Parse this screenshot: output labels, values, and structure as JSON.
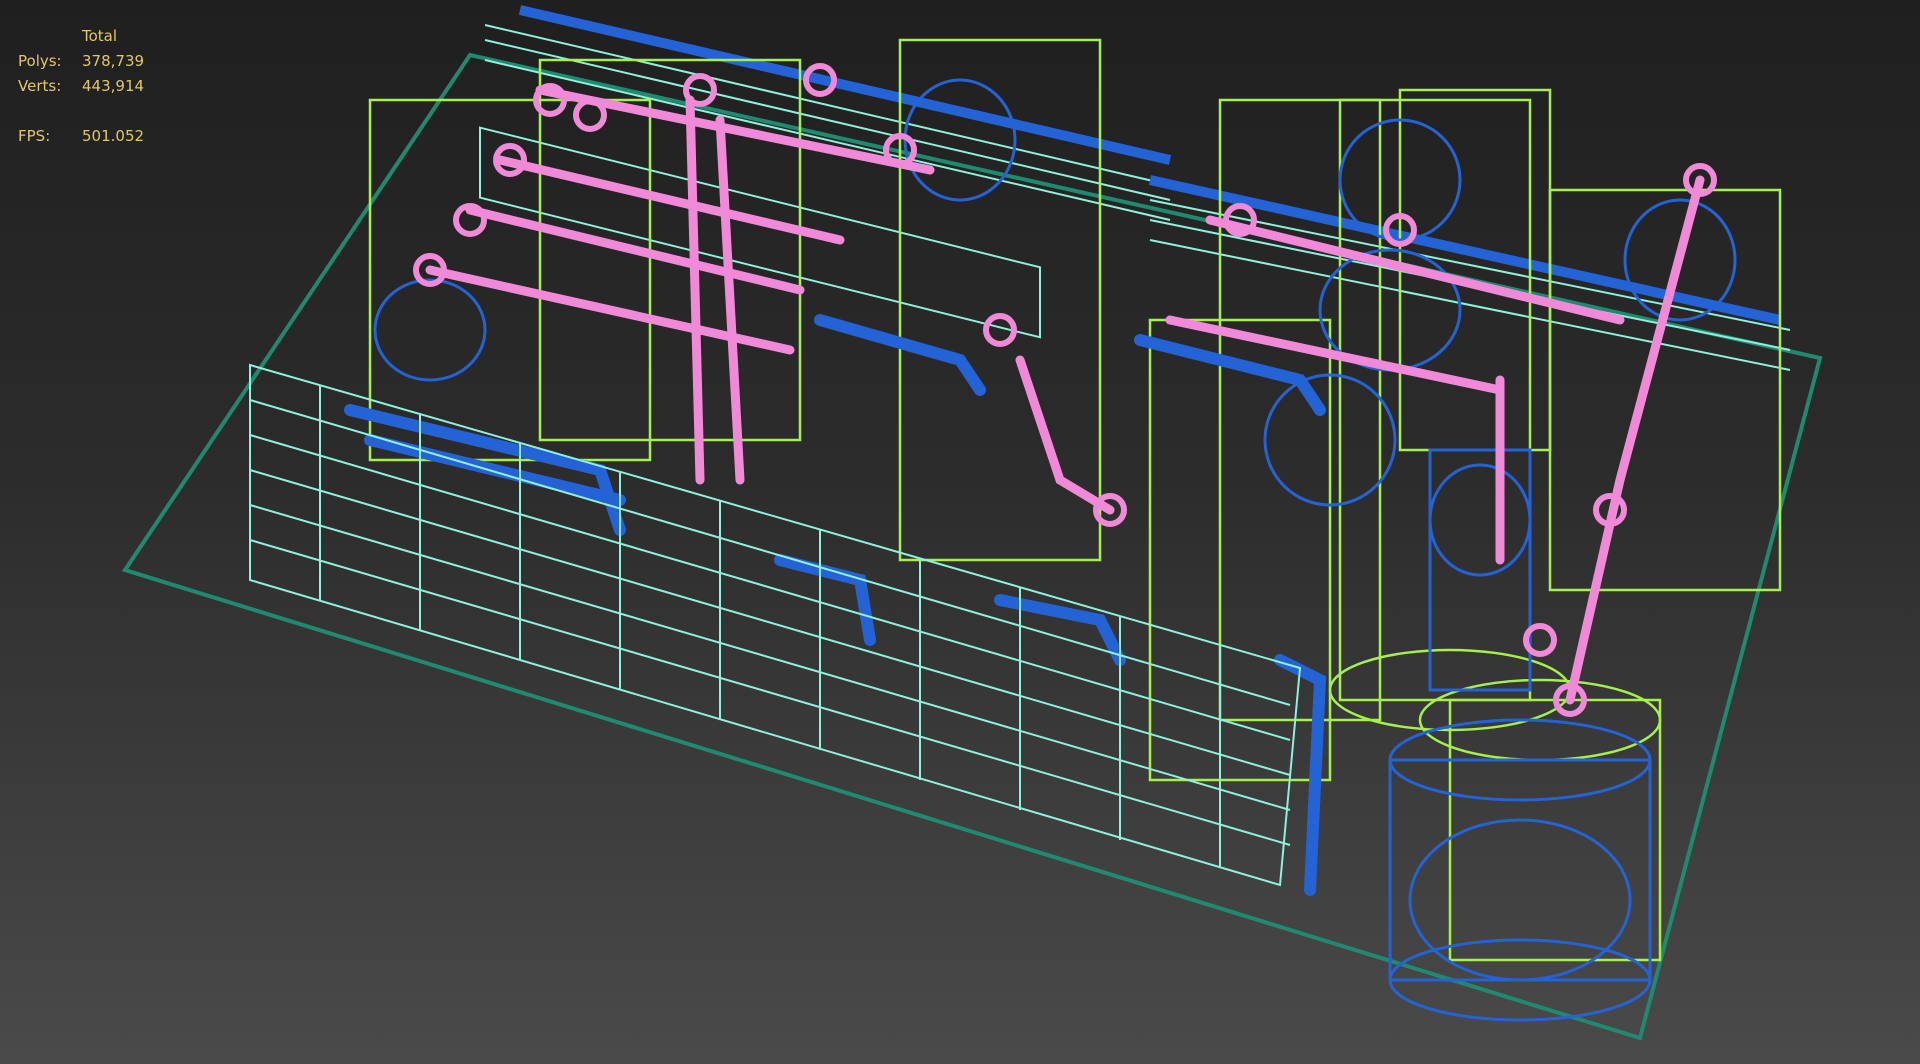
{
  "viewport": {
    "stats": {
      "header": "Total",
      "polys_label": "Polys:",
      "polys_value": "378,739",
      "verts_label": "Verts:",
      "verts_value": "443,914",
      "fps_label": "FPS:",
      "fps_value": "501.052"
    },
    "colors": {
      "background_top": "#1f1f1f",
      "background_bottom": "#4a4a4a",
      "ground_plane": "#1f8a70",
      "cyan_wire": "#8ff0dc",
      "lime_wire": "#a6f04a",
      "blue_wire": "#2463d6",
      "pink_wire": "#f08ad8",
      "stats_text": "#e2c768"
    }
  }
}
